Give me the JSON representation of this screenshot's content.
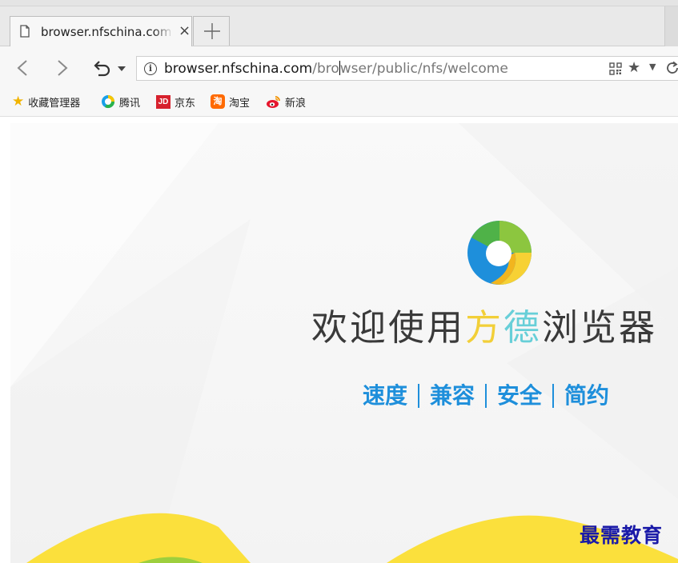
{
  "tab": {
    "title": "browser.nfschina.com/browser/public/nfs/welcome",
    "close_glyph": "×",
    "icon": "page-icon"
  },
  "navbar": {
    "back_icon": "chevron-left-icon",
    "forward_icon": "chevron-right-icon",
    "history_icon": "undo-icon",
    "address": {
      "host": "browser.nfschina.com",
      "path_before_caret": "/bro",
      "path_after_caret": "wser/public/nfs/welcome"
    },
    "right_icons": [
      "qr-code-icon",
      "star-icon",
      "dropdown-icon",
      "reload-icon"
    ]
  },
  "bookmarks": [
    {
      "label": "收藏管理器",
      "icon": "star-icon",
      "color": "#f1b400"
    },
    {
      "label": "腾讯",
      "icon": "tencent-icon"
    },
    {
      "label": "京东",
      "icon": "jd-icon",
      "icon_text": "JD",
      "color": "#d7212d"
    },
    {
      "label": "淘宝",
      "icon": "taobao-icon",
      "icon_text": "淘",
      "color": "#ff6a00"
    },
    {
      "label": "新浪",
      "icon": "weibo-icon",
      "color": "#e6162d"
    }
  ],
  "page": {
    "welcome_prefix": "欢迎使用",
    "welcome_fang": "方",
    "welcome_de": "德",
    "welcome_suffix": "浏览器",
    "features": [
      "速度",
      "兼容",
      "安全",
      "简约"
    ],
    "colors": {
      "fang": "#f2cf38",
      "de": "#68cfd8",
      "features": "#1e8fdb",
      "logo_green": "#8cc63f",
      "logo_blue": "#1e8fdb",
      "logo_yellow": "#f7d134",
      "wave_yellow": "#fbe03c"
    }
  },
  "watermark": "最需教育"
}
